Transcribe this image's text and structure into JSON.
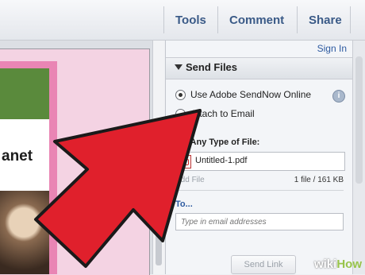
{
  "toolbar": {
    "tools": "Tools",
    "comment": "Comment",
    "share": "Share"
  },
  "panel": {
    "sign_in": "Sign In",
    "section_title": "Send Files",
    "option_sendnow": "Use Adobe SendNow Online",
    "option_email": "Attach to Email",
    "select_label": "ect Any Type of File:",
    "file_name": "Untitled-1.pdf",
    "add_file": "Add File",
    "file_info": "1 file / 161 KB",
    "to_label": "To...",
    "to_placeholder": "Type in email addresses",
    "send_link": "Send Link"
  },
  "document": {
    "slide_text": "anet"
  },
  "brand": {
    "wiki": "wiki",
    "how": "How"
  },
  "colors": {
    "accent": "#3a5a87",
    "arrow": "#e0202c",
    "slide_pink": "#e985b4",
    "background_pink": "#f4d3e3"
  }
}
